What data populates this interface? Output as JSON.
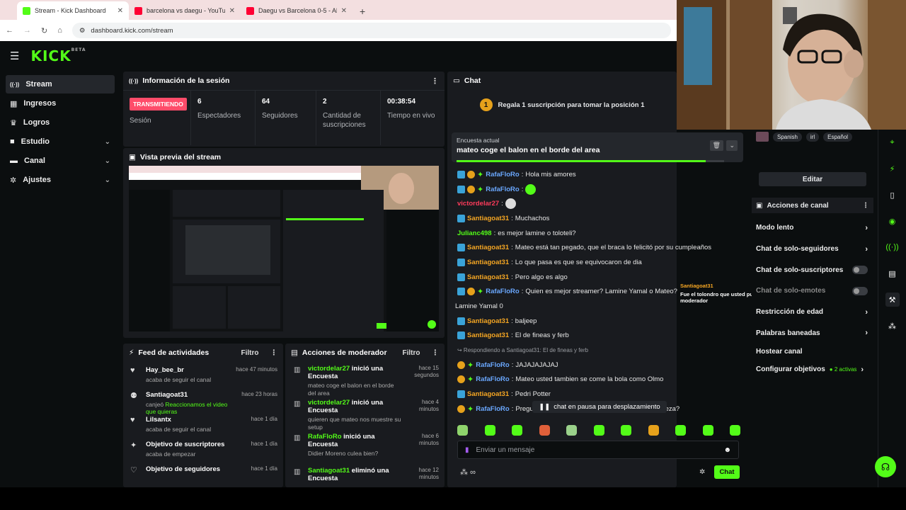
{
  "browser": {
    "tabs": [
      {
        "title": "Stream - Kick Dashboard",
        "color": "#53fc18",
        "active": true
      },
      {
        "title": "barcelona vs daegu - YouTube",
        "color": "#ff0033",
        "active": false
      },
      {
        "title": "Daegu vs Barcelona 0-5 - All G",
        "color": "#ff0033",
        "active": false
      }
    ],
    "new_tab": "+",
    "url": "dashboard.kick.com/stream"
  },
  "app": {
    "logo": "KICK",
    "logo_sup": "BETA"
  },
  "sidebar": {
    "items": [
      {
        "label": "Stream",
        "icon": "radio-icon",
        "glyph": "((·))",
        "active": true,
        "expand": false
      },
      {
        "label": "Ingresos",
        "icon": "money-icon",
        "glyph": "▦",
        "active": false,
        "expand": false
      },
      {
        "label": "Logros",
        "icon": "trophy-icon",
        "glyph": "♛",
        "active": false,
        "expand": false
      },
      {
        "label": "Estudio",
        "icon": "studio-icon",
        "glyph": "■",
        "active": false,
        "expand": true
      },
      {
        "label": "Canal",
        "icon": "channel-icon",
        "glyph": "▬",
        "active": false,
        "expand": true
      },
      {
        "label": "Ajustes",
        "icon": "gear-icon",
        "glyph": "✲",
        "active": false,
        "expand": true
      }
    ]
  },
  "session": {
    "title": "Información de la sesión",
    "status_badge": "TRANSMITIENDO",
    "status_label": "Sesión",
    "stats": [
      {
        "value": "6",
        "label": "Espectadores"
      },
      {
        "value": "64",
        "label": "Seguidores"
      },
      {
        "value": "2",
        "label": "Cantidad de suscripciones"
      },
      {
        "value": "00:38:54",
        "label": "Tiempo en vivo"
      }
    ]
  },
  "preview": {
    "title": "Vista previa del stream"
  },
  "activity": {
    "title": "Feed de actividades",
    "filter": "Filtro",
    "items": [
      {
        "icon": "heart-icon",
        "glyph": "♥",
        "name": "Hay_bee_br",
        "sub": "acaba de seguir el canal",
        "time": "hace 47 minutos",
        "green": false
      },
      {
        "icon": "exchange-icon",
        "glyph": "⚉",
        "name": "Santiagoat31",
        "sub_prefix": "canjeó ",
        "sub": "Reaccionamos el video que quieras",
        "time": "hace 23 horas",
        "green": true
      },
      {
        "icon": "heart-icon",
        "glyph": "♥",
        "name": "Lilsantx",
        "sub": "acaba de seguir el canal",
        "time": "hace 1 día",
        "green": false
      },
      {
        "icon": "goal-icon",
        "glyph": "✦",
        "name": "Objetivo de suscriptores",
        "sub": "acaba de empezar",
        "time": "hace 1 día",
        "green": false
      },
      {
        "icon": "heart-outline-icon",
        "glyph": "♡",
        "name": "Objetivo de seguidores",
        "sub": "",
        "time": "hace 1 día",
        "green": false
      }
    ]
  },
  "mod": {
    "title": "Acciones de moderador",
    "filter": "Filtro",
    "items": [
      {
        "name": "victordelar27",
        "action": " inició una Encuesta",
        "detail": "mateo coge el balon en el borde del area",
        "time": "hace 15 segundos"
      },
      {
        "name": "victordelar27",
        "action": " inició una Encuesta",
        "detail": "quieren que mateo nos muestre su setup",
        "time": "hace 4 minutos"
      },
      {
        "name": "RafaFloRo",
        "action": " inició una Encuesta",
        "detail": "Didier Moreno culea bien?",
        "time": "hace 6 minutos"
      },
      {
        "name": "Santiagoat31",
        "action": " eliminó una Encuesta",
        "detail": "",
        "time": "hace 12 minutos"
      }
    ]
  },
  "chat": {
    "title": "Chat",
    "gift_text": "Regala 1 suscripción para tomar la posición 1",
    "gift_rank": "1",
    "poll_label": "Encuesta actual",
    "poll_question": "mateo coge el balon en el borde del area",
    "poll_progress_pct": 93,
    "messages": [
      {
        "user": "RafaFloRo",
        "color": "#6aa8ff",
        "badges": [
          "blue",
          "gold",
          "green"
        ],
        "text": "Hola mis amores"
      },
      {
        "user": "RafaFloRo",
        "color": "#6aa8ff",
        "badges": [
          "blue",
          "gold",
          "green"
        ],
        "text": "",
        "emote": true
      },
      {
        "user": "victordelar27",
        "color": "#ff3b5b",
        "badges": [],
        "text": "",
        "emote": true
      },
      {
        "user": "Santiagoat31",
        "color": "#f5a623",
        "badges": [
          "blue"
        ],
        "text": "Muchachos"
      },
      {
        "user": "Julianc498",
        "color": "#53fc18",
        "badges": [],
        "text": "es mejor lamine o toloteli?"
      },
      {
        "user": "Santiagoat31",
        "color": "#f5a623",
        "badges": [
          "blue"
        ],
        "text": "Mateo está tan pegado, que el braca lo felicitó por su cumpleaños"
      },
      {
        "user": "Santiagoat31",
        "color": "#f5a623",
        "badges": [
          "blue"
        ],
        "text": "Lo que pasa es que se equivocaron de dia"
      },
      {
        "user": "Santiagoat31",
        "color": "#f5a623",
        "badges": [
          "blue"
        ],
        "text": "Pero algo es algo"
      },
      {
        "user": "RafaFloRo",
        "color": "#6aa8ff",
        "badges": [
          "blue",
          "gold",
          "green"
        ],
        "text": "Quien es mejor streamer? Lamine Yamal o Mateo? Mi"
      },
      {
        "user": "",
        "color": "#e8e8e8",
        "badges": [],
        "text": "Lamine Yamal 0"
      },
      {
        "user": "Santiagoat31",
        "color": "#f5a623",
        "badges": [
          "blue"
        ],
        "text": "baljeep"
      },
      {
        "user": "Santiagoat31",
        "color": "#f5a623",
        "badges": [
          "blue"
        ],
        "text": "El de fineas y ferb"
      },
      {
        "user": "",
        "color": "#9a9da2",
        "badges": [],
        "text": "↪ Respondiendo a Santiagoat31: El de fineas y ferb",
        "reply": true
      },
      {
        "user": "RafaFloRo",
        "color": "#6aa8ff",
        "badges": [
          "gold",
          "green"
        ],
        "text": "JAJAJAJAJAJ"
      },
      {
        "user": "RafaFloRo",
        "color": "#6aa8ff",
        "badges": [
          "gold",
          "green"
        ],
        "text": "Mateo usted tambien se come la bola como Olmo"
      },
      {
        "user": "Santiagoat31",
        "color": "#f5a623",
        "badges": [
          "blue"
        ],
        "text": "Pedri Potter"
      },
      {
        "user": "RafaFloRo",
        "color": "#6aa8ff",
        "badges": [
          "gold",
          "green"
        ],
        "text": "Pregunta seria: Pedri es mejor que Fabian Sambueza?"
      },
      {
        "user": "Santiagoat31",
        "color": "#f5a623",
        "badges": [
          "blue"
        ],
        "text": "Mateo e"
      }
    ],
    "pause_text": "chat en pausa para desplazamiento",
    "tooltip_user": "Santiagoat31",
    "tooltip_text": "Fue el tolondro que usted puso de moderador",
    "input_placeholder": "Enviar un mensaje",
    "send_label": "Chat",
    "emote_count": 10
  },
  "right": {
    "languages": [
      "Spanish",
      "irl",
      "Español"
    ],
    "edit_label": "Editar",
    "actions_title": "Acciones de canal",
    "actions": [
      {
        "label": "Modo lento",
        "kind": "chev"
      },
      {
        "label": "Chat de solo-seguidores",
        "kind": "chev"
      },
      {
        "label": "Chat de solo-suscriptores",
        "kind": "toggle"
      },
      {
        "label": "Chat de solo-emotes",
        "kind": "toggle"
      },
      {
        "label": "Restricción de edad",
        "kind": "chev"
      },
      {
        "label": "Palabras baneadas",
        "kind": "chev"
      },
      {
        "label": "Hostear canal",
        "kind": "none"
      },
      {
        "label": "Configurar objetivos",
        "kind": "chev",
        "extra": "● 2 activas"
      }
    ]
  },
  "colors": {
    "accent": "#53fc18",
    "live": "#ff4c6a",
    "panel": "#191b1f",
    "bg": "#0b0e0f"
  }
}
